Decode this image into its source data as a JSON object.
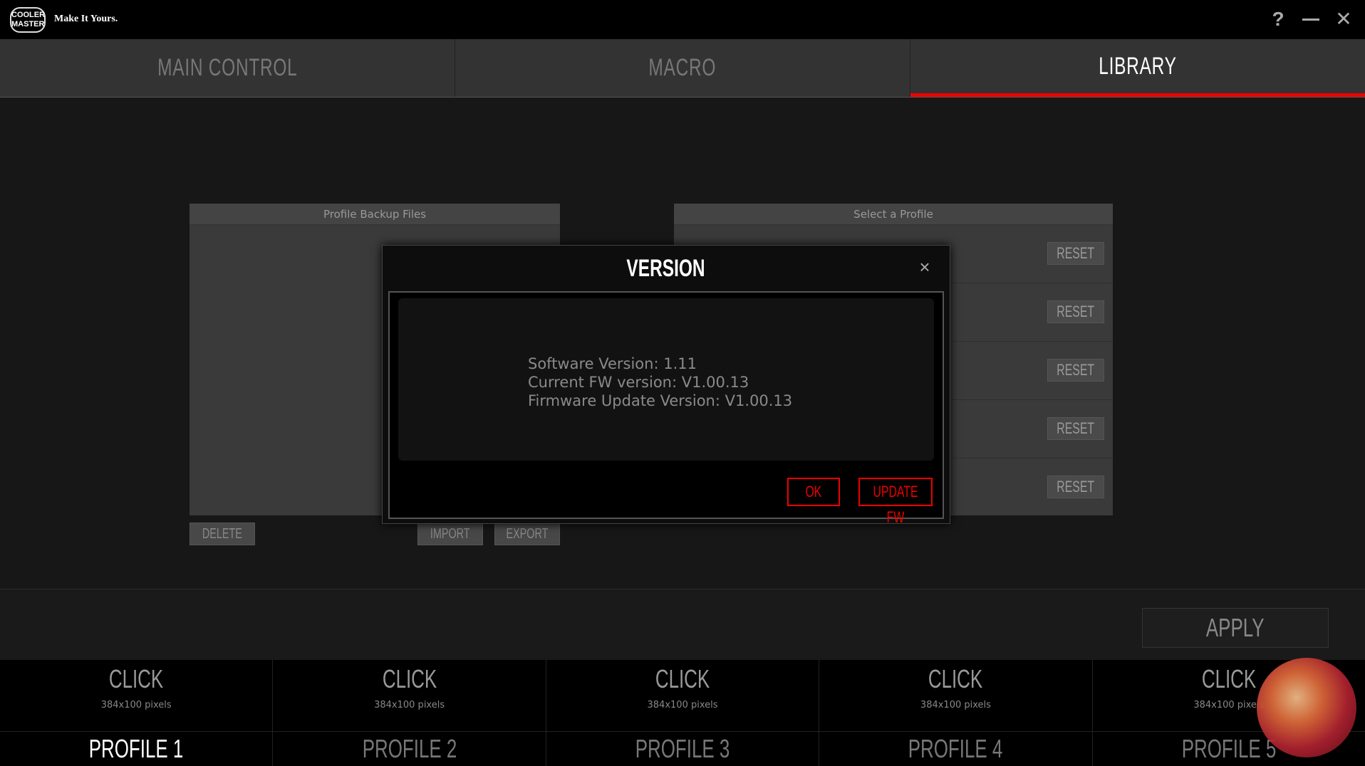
{
  "titlebar": {
    "logo_text": "COOLER MASTER",
    "tagline": "Make It Yours.",
    "help_label": "?",
    "close_label": "✕"
  },
  "tabs": [
    {
      "label": "MAIN CONTROL",
      "active": false
    },
    {
      "label": "MACRO",
      "active": false
    },
    {
      "label": "LIBRARY",
      "active": true
    }
  ],
  "library": {
    "backup_header": "Profile Backup Files",
    "select_header": "Select a Profile",
    "reset_label": "RESET",
    "delete_label": "DELETE",
    "import_label": "IMPORT",
    "export_label": "EXPORT"
  },
  "apply_label": "APPLY",
  "profiles": [
    {
      "click": "CLICK",
      "size": "384x100 pixels",
      "name": "PROFILE 1",
      "active": true
    },
    {
      "click": "CLICK",
      "size": "384x100 pixels",
      "name": "PROFILE 2",
      "active": false
    },
    {
      "click": "CLICK",
      "size": "384x100 pixels",
      "name": "PROFILE 3",
      "active": false
    },
    {
      "click": "CLICK",
      "size": "384x100 pixels",
      "name": "PROFILE 4",
      "active": false
    },
    {
      "click": "CLICK",
      "size": "384x100 pixels",
      "name": "PROFILE 5",
      "active": false
    }
  ],
  "dialog": {
    "title": "VERSION",
    "close_label": "×",
    "software_version": "Software Version: 1.11",
    "current_fw": "Current FW version: V1.00.13",
    "update_fw_version": "Firmware Update Version: V1.00.13",
    "ok_label": "OK",
    "update_label": "UPDATE FW"
  },
  "colors": {
    "accent": "#e00000",
    "background": "#171717",
    "tab_bg": "#333333"
  }
}
